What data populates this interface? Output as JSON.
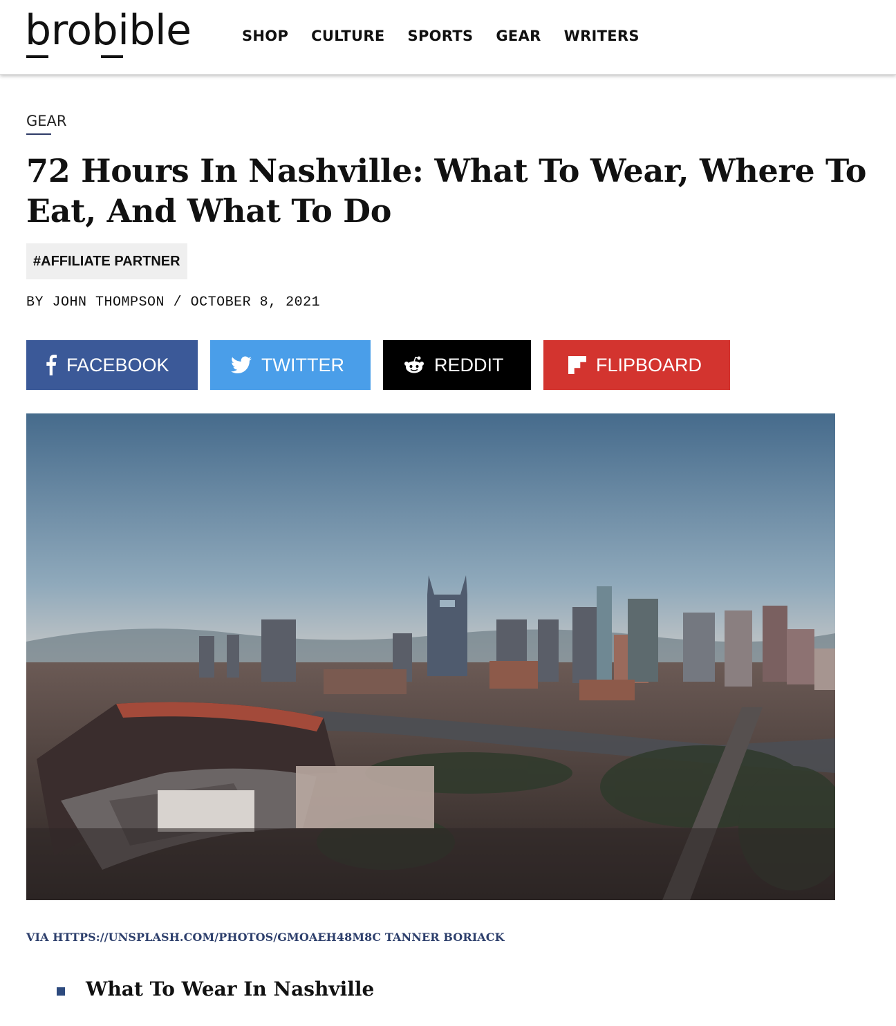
{
  "header": {
    "logo": "brobible",
    "nav": [
      "SHOP",
      "CULTURE",
      "SPORTS",
      "GEAR",
      "WRITERS"
    ]
  },
  "article": {
    "category": "GEAR",
    "title": "72 Hours In Nashville: What To Wear, Where To Eat, And What To Do",
    "tag": "#AFFILIATE PARTNER",
    "byline_prefix": "BY",
    "author": "JOHN THOMPSON",
    "separator": "/",
    "date": "OCTOBER 8, 2021",
    "image_credit": "VIA HTTPS://UNSPLASH.COM/PHOTOS/GMOAEH48M8C TANNER BORIACK",
    "toc_first_item": "What To Wear In Nashville"
  },
  "share": {
    "facebook": "FACEBOOK",
    "twitter": "TWITTER",
    "reddit": "REDDIT",
    "flipboard": "FLIPBOARD"
  },
  "colors": {
    "facebook": "#3b5998",
    "twitter": "#4a9ee9",
    "reddit": "#000000",
    "flipboard": "#d3342f",
    "link": "#2d3f6c"
  },
  "icons": {
    "facebook": "facebook-icon",
    "twitter": "twitter-bird-icon",
    "reddit": "reddit-alien-icon",
    "flipboard": "flipboard-icon"
  }
}
